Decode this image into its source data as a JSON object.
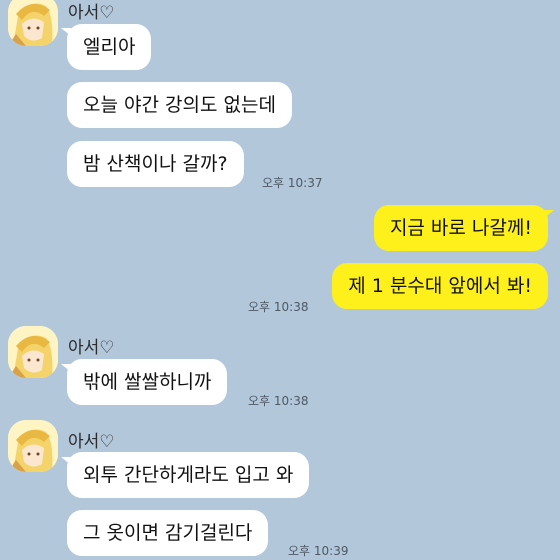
{
  "sender_name": "아서♡",
  "group1": {
    "messages": [
      "엘리아",
      "오늘 야간 강의도 없는데",
      "밤 산책이나 갈까?"
    ],
    "time": "오후 10:37"
  },
  "group2": {
    "messages": [
      "지금 바로 나갈께!",
      "제 1 분수대 앞에서 봐!"
    ],
    "time": "오후 10:38"
  },
  "group3": {
    "messages": [
      "밖에 쌀쌀하니까"
    ],
    "time": "오후 10:38"
  },
  "group4": {
    "messages": [
      "외투 간단하게라도 입고 와",
      "그 옷이면 감기걸린다"
    ],
    "time": "오후 10:39"
  },
  "colors": {
    "background": "#b2c7da",
    "incoming_bubble": "#ffffff",
    "outgoing_bubble": "#fef01b"
  },
  "icons": {
    "avatar": "anime-profile-avatar"
  }
}
